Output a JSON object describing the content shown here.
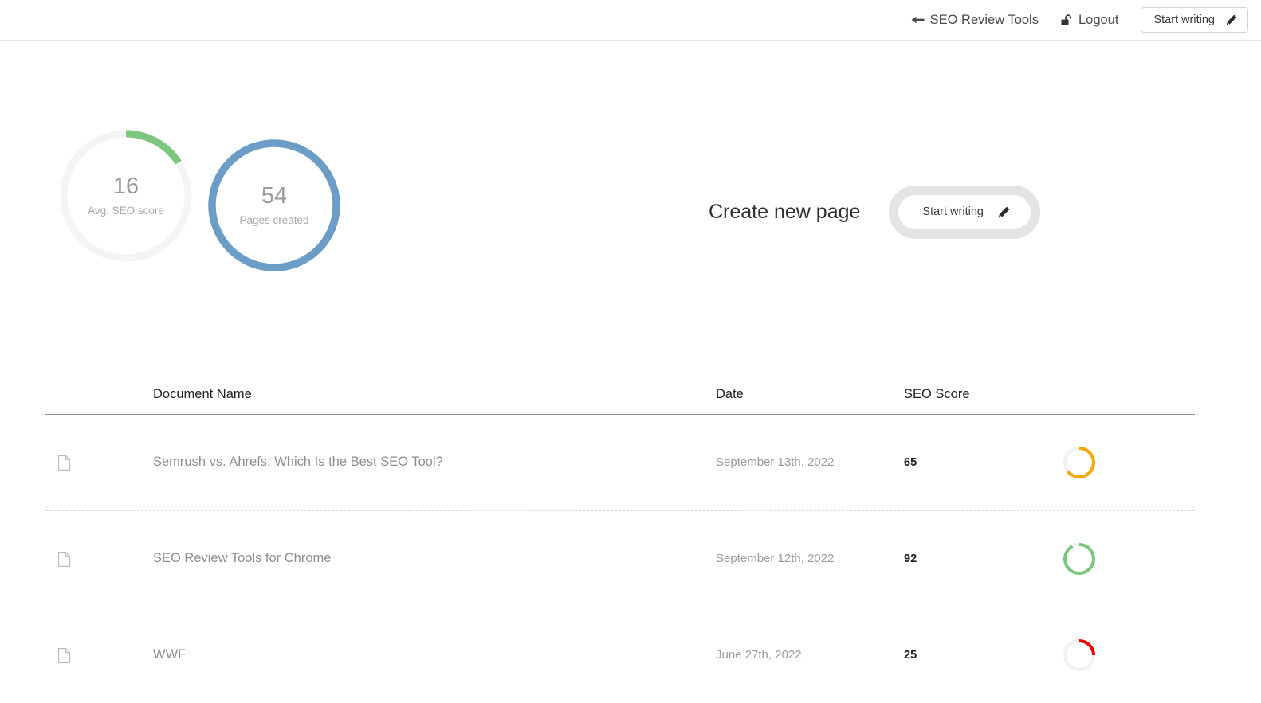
{
  "header": {
    "back_link": {
      "label": "SEO Review Tools",
      "icon": "arrow-left-icon"
    },
    "logout_link": {
      "label": "Logout",
      "icon": "unlock-icon"
    },
    "start_writing_button": {
      "label": "Start writing",
      "icon": "pencil-icon"
    }
  },
  "stats": {
    "gauges": [
      {
        "value": "16",
        "label": "Avg. SEO score",
        "percent": 16,
        "arc_color": "#7dc67d",
        "track_color": "#f4f4f4"
      },
      {
        "value": "54",
        "label": "Pages created",
        "percent": 100,
        "arc_color": "#6b9dc6",
        "track_color": "#6b9dc6"
      }
    ]
  },
  "create_page": {
    "title": "Create new page",
    "button": {
      "label": "Start writing",
      "icon": "pencil-icon"
    }
  },
  "documents_table": {
    "columns": {
      "icon": "",
      "name": "Document Name",
      "date": "Date",
      "score": "SEO Score",
      "ring": ""
    },
    "rows": [
      {
        "icon": "file-icon",
        "name": "Semrush vs. Ahrefs: Which Is the Best SEO Tool?",
        "date": "September 13th, 2022",
        "score": "65",
        "percent": 65,
        "ring_color": "#f7a800"
      },
      {
        "icon": "file-icon",
        "name": "SEO Review Tools for Chrome",
        "date": "September 12th, 2022",
        "score": "92",
        "percent": 92,
        "ring_color": "#79c77f"
      },
      {
        "icon": "file-icon",
        "name": "WWF",
        "date": "June 27th, 2022",
        "score": "25",
        "percent": 25,
        "ring_color": "#f00000"
      }
    ]
  },
  "colors": {
    "green": "#7dc67d",
    "blue": "#6b9dc6",
    "orange": "#f7a800",
    "red": "#f00000",
    "track": "#f4f4f4",
    "mini_track": "#f1f1f1"
  }
}
